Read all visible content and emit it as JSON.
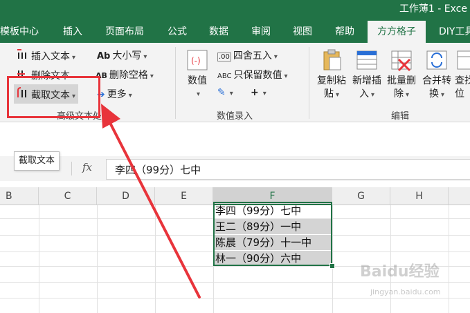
{
  "title": "工作薄1 - Exce",
  "tabs": [
    "模板中心",
    "插入",
    "页面布局",
    "公式",
    "数据",
    "审阅",
    "视图",
    "帮助",
    "方方格子",
    "DIY工具"
  ],
  "active_tab": "方方格子",
  "ribbon": {
    "insert_text": "插入文本",
    "delete_text": "删除文本",
    "extract_text": "截取文本",
    "case": "大小写",
    "delete_spaces": "删除空格",
    "more": "更多",
    "case_icon_text": "Ab",
    "delete_spaces_icon_text": "AB",
    "group_advanced_text": "高级文本处理",
    "numeric_label": "数值",
    "round_label": "四舍五入",
    "keep_values_label": "只保留数值",
    "round_icon_text": ".00",
    "keep_values_icon_text": "ABC",
    "group_numeric_entry": "数值录入",
    "copy_paste_line1": "复制粘",
    "copy_paste_line2": "贴",
    "new_insert_line1": "新增插",
    "new_insert_line2": "入",
    "batch_delete_line1": "批量删",
    "batch_delete_line2": "除",
    "merge_convert_line1": "合并转",
    "merge_convert_line2": "换",
    "find_line1": "查找",
    "find_line2": "位",
    "group_edit": "编辑"
  },
  "formula_bar": {
    "tooltip": "截取文本",
    "fx": "fx",
    "content": "李四（99分）七中"
  },
  "columns": [
    "B",
    "C",
    "D",
    "E",
    "F",
    "G",
    "H"
  ],
  "selected_column": "F",
  "cells": [
    "李四（99分）七中",
    "王二（89分）一中",
    "陈晨（79分）十一中",
    "林一（90分）六中"
  ],
  "watermark": "Baidu经验",
  "watermark_sub": "jingyan.baidu.com",
  "colors": {
    "excel_green": "#217346",
    "annotation_red": "#e8343b"
  }
}
